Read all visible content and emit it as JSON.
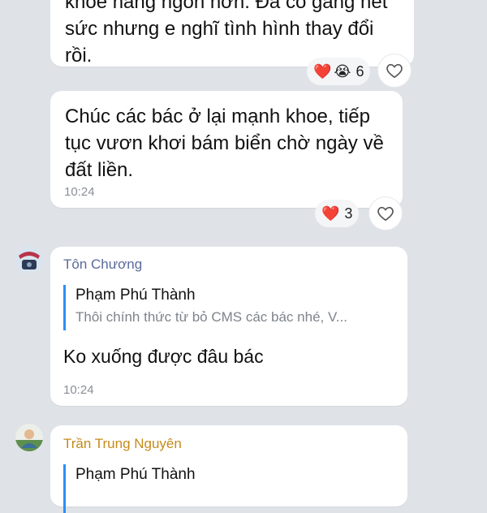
{
  "messages": [
    {
      "lines": [
        "khoẻ năng ngon hơn. Đã cố gắng hết",
        "sức nhưng e nghĩ tình hình thay đổi",
        "rồi."
      ],
      "reactions": {
        "emojis": [
          "❤️",
          "😭"
        ],
        "count": "6"
      }
    },
    {
      "lines": [
        "Chúc các bác ở lại mạnh khoe, tiếp",
        "tục vươn khơi bám biển chờ ngày về",
        "đất liền."
      ],
      "time": "10:24",
      "reactions": {
        "emojis": [
          "❤️"
        ],
        "count": "3"
      }
    },
    {
      "sender": "Tôn Chương",
      "sender_color": "#5a6b9a",
      "quote": {
        "author": "Phạm Phú Thành",
        "text": "Thôi chính thức từ bỏ CMS các bác nhé, V..."
      },
      "text": "Ko xuống được đâu bác",
      "time": "10:24"
    },
    {
      "sender": "Trần Trung Nguyên",
      "sender_color": "#c58a1a",
      "quote": {
        "author": "Phạm Phú Thành"
      }
    }
  ],
  "colors": {
    "background": "#dfe3e8",
    "quote_bar": "#2c8ef4",
    "heart": "#e0263c"
  },
  "icons": {
    "reaction_button": "heart-outline-icon"
  }
}
